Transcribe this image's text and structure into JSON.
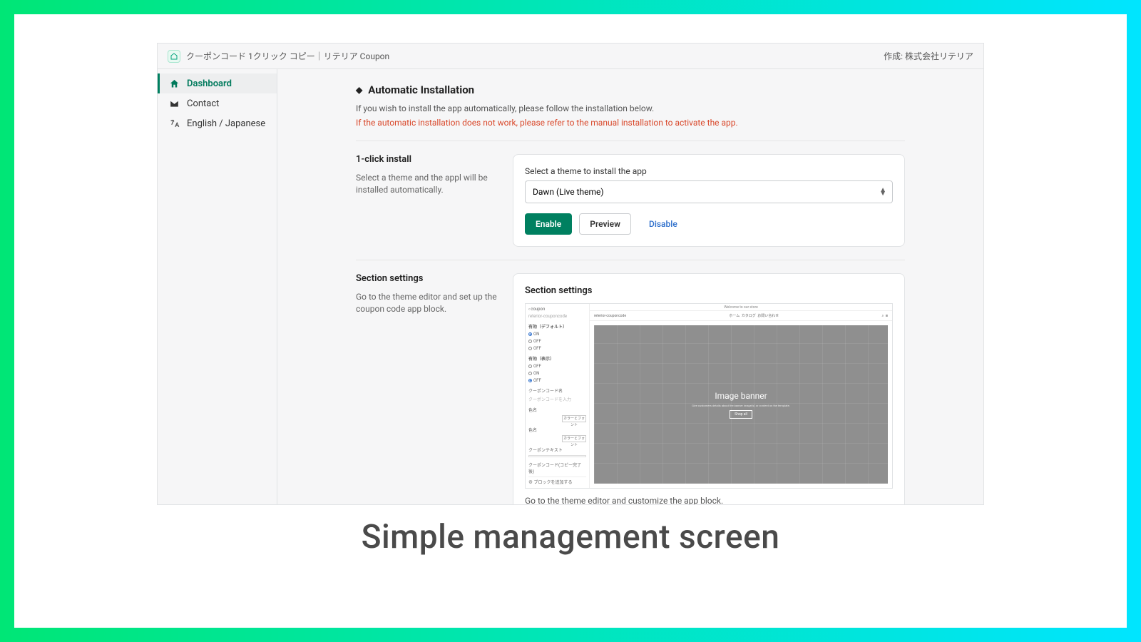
{
  "header": {
    "app_title": "クーポンコード 1クリック コピー｜リテリア Coupon",
    "author_label": "作成: 株式会社リテリア"
  },
  "sidebar": {
    "items": [
      {
        "label": "Dashboard",
        "icon": "home-icon"
      },
      {
        "label": "Contact",
        "icon": "mail-icon"
      },
      {
        "label": "English / Japanese",
        "icon": "language-icon"
      }
    ]
  },
  "main": {
    "title": "Automatic Installation",
    "desc": "If you wish to install the app automatically, please follow the installation below.",
    "warn": "If the automatic installation does not work, please refer to the manual installation to activate the app."
  },
  "install": {
    "title": "1-click install",
    "desc": "Select a theme and the appl will be installed automatically.",
    "select_label": "Select a theme to install the app",
    "selected_theme": "Dawn (Live theme)",
    "enable": "Enable",
    "preview": "Preview",
    "disable": "Disable"
  },
  "section": {
    "title_left": "Section settings",
    "desc_left": "Go to the theme editor and set up the coupon code app block.",
    "card_title": "Section settings",
    "caption": "Go to the theme editor and customize the app block."
  },
  "editor": {
    "back": "coupon",
    "sub": "reterior-couponcode",
    "group1": "有効（デフォルト）",
    "opt_on": "ON",
    "opt_off": "OFF",
    "group2": "有効（表示）",
    "label_code": "クーポンコード名",
    "ph_code": "クーポンコードを入力",
    "label_a": "色名",
    "mini_btn": "カラーとフォント",
    "label_b": "色名",
    "label_text": "クーポンテキスト",
    "label_copy": "クーポンコード(コピー完了後)",
    "add_block": "ブロックを追加する",
    "announce": "Welcome to our store",
    "brand": "reterior-couponcode",
    "nav1": "ホーム",
    "nav2": "カタログ",
    "nav3": "お問い合わせ",
    "hero_title": "Image banner",
    "hero_sub": "Give customers details about the banner image(s) or content on the template.",
    "hero_btn": "Shop all"
  },
  "footer_caption": "Simple management screen"
}
